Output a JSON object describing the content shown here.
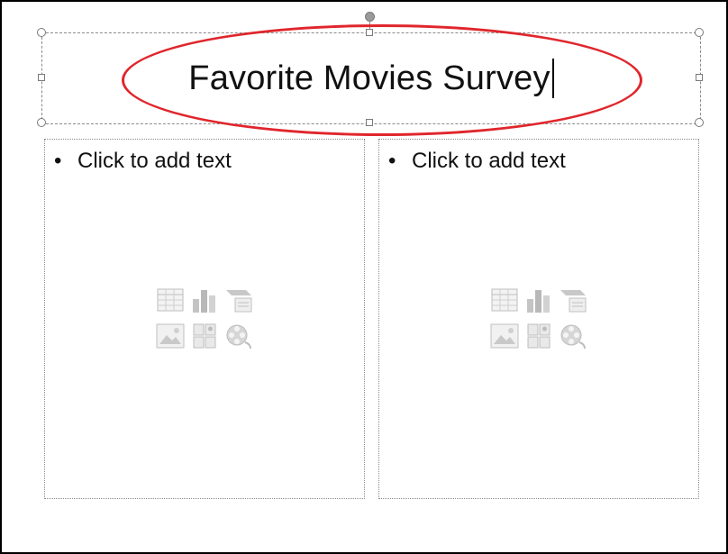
{
  "slide": {
    "title": "Favorite Movies Survey"
  },
  "content_left": {
    "placeholder_text": "Click to add text",
    "icons": [
      "insert-table-icon",
      "insert-chart-icon",
      "insert-smartart-icon",
      "insert-picture-icon",
      "insert-clipart-icon",
      "insert-media-icon"
    ]
  },
  "content_right": {
    "placeholder_text": "Click to add text",
    "icons": [
      "insert-table-icon",
      "insert-chart-icon",
      "insert-smartart-icon",
      "insert-picture-icon",
      "insert-clipart-icon",
      "insert-media-icon"
    ]
  },
  "colors": {
    "highlight_ring": "#e0262c",
    "placeholder_icons": "#c8c8c8"
  }
}
